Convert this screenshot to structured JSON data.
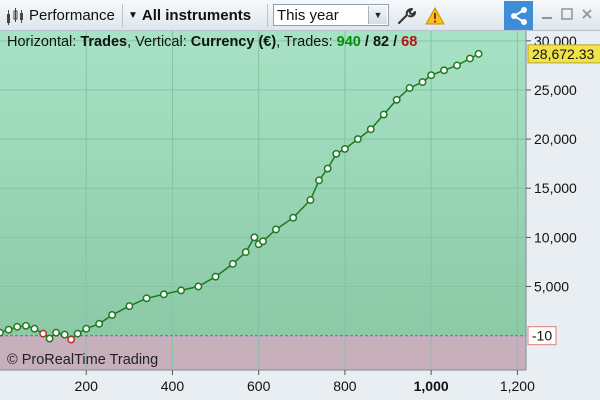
{
  "toolbar": {
    "report_label": "Performance",
    "instruments_label": "All instruments",
    "period_value": "This year",
    "icons": {
      "report": "performance-icon",
      "caret": "caret-down-icon",
      "dropdown": "dropdown-arrow-icon",
      "settings": "wrench-icon",
      "warning": "warning-icon",
      "share": "share-icon",
      "minimize": "minimize-icon",
      "maximize": "maximize-icon",
      "close": "close-icon"
    }
  },
  "legend": {
    "horizontal_prefix": "Horizontal: ",
    "horizontal_value": "Trades",
    "vertical_prefix": ", Vertical: ",
    "vertical_value": "Currency (€)",
    "trades_prefix": ", Trades: ",
    "trades_total": "940",
    "sep1": " / ",
    "trades_winning": "82",
    "sep2": " / ",
    "trades_losing": "68"
  },
  "copyright": "© ProRealTime Trading",
  "colors": {
    "positive_area": "#a8dcc1",
    "negative_area": "#c7b0bc",
    "equity_line": "#1f7a1f",
    "win_marker": "#1f7a1f",
    "loss_marker": "#b03030",
    "current_value_bg": "#f2e24a"
  },
  "chart_data": {
    "type": "line",
    "xlabel": "",
    "ylabel": "",
    "xlim": [
      0,
      1220
    ],
    "ylim": [
      -3500,
      31000
    ],
    "x_ticks": [
      "200",
      "400",
      "600",
      "800",
      "1,000",
      "1,200"
    ],
    "x_tick_values": [
      200,
      400,
      600,
      800,
      1000,
      1200
    ],
    "y_ticks": [
      "5,000",
      "10,000",
      "15,000",
      "20,000",
      "25,000",
      "30,000"
    ],
    "y_tick_values": [
      5000,
      10000,
      15000,
      20000,
      25000,
      30000
    ],
    "reference_value": -10,
    "reference_label": "-10",
    "current_value": 28672.33,
    "current_value_label": "28,672.33",
    "series": [
      {
        "x": [
          0,
          20,
          40,
          60,
          80,
          100,
          115,
          130,
          150,
          165,
          180,
          200,
          230,
          260,
          300,
          340,
          380,
          420,
          460,
          500,
          540,
          570,
          590,
          600,
          610,
          640,
          680,
          720,
          740,
          760,
          780,
          800,
          830,
          860,
          890,
          920,
          950,
          980,
          1000,
          1030,
          1060,
          1090,
          1110
        ],
        "y": [
          300,
          600,
          900,
          1000,
          700,
          200,
          -300,
          300,
          100,
          -400,
          200,
          700,
          1200,
          2100,
          3000,
          3800,
          4200,
          4600,
          5000,
          6000,
          7300,
          8500,
          10000,
          9300,
          9600,
          10800,
          12000,
          13800,
          15800,
          17000,
          18500,
          19000,
          20000,
          21000,
          22500,
          24000,
          25200,
          25800,
          26500,
          27000,
          27500,
          28200,
          28672
        ]
      }
    ],
    "losing_trades_x": [
      100,
      165
    ]
  }
}
